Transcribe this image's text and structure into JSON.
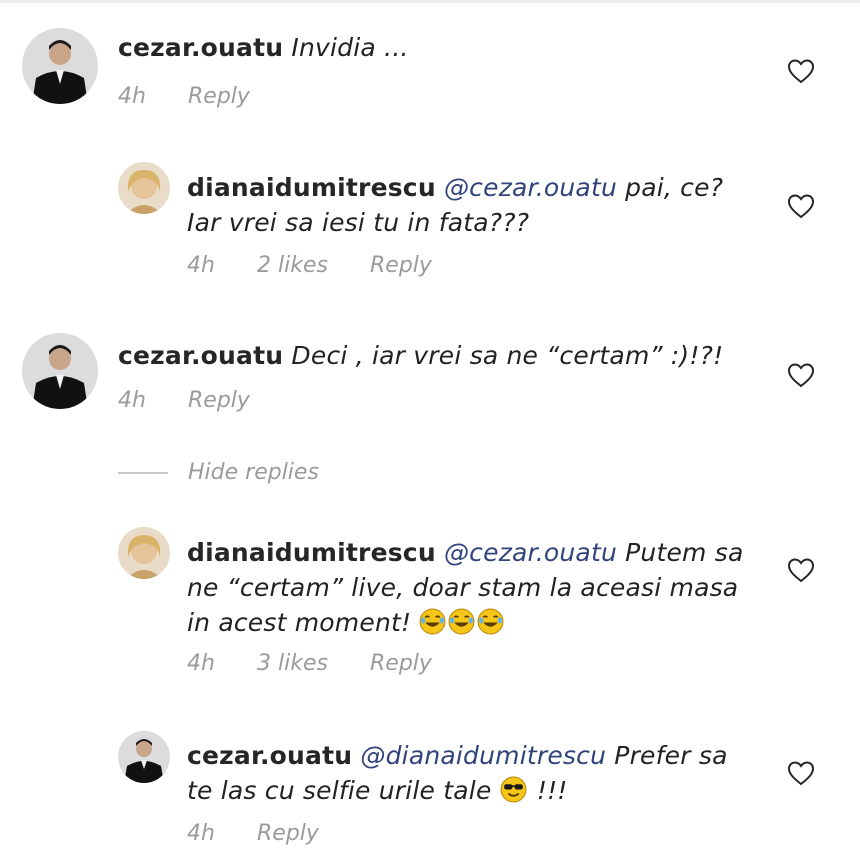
{
  "comments": [
    {
      "username": "cezar.ouatu",
      "mention": "",
      "text": "Invidia ...",
      "time": "4h",
      "likes": "",
      "reply": "Reply"
    },
    {
      "username": "dianaidumitrescu",
      "mention": "@cezar.ouatu",
      "text_line1": "pai, ce?",
      "text_line2": "Iar vrei sa iesi tu in fata???",
      "time": "4h",
      "likes": "2 likes",
      "reply": "Reply"
    },
    {
      "username": "cezar.ouatu",
      "mention": "",
      "text": "Deci , iar vrei sa ne “certam” :)!?!",
      "time": "4h",
      "likes": "",
      "reply": "Reply"
    },
    {
      "username": "dianaidumitrescu",
      "mention": "@cezar.ouatu",
      "text_line1": "Putem sa",
      "text_line2": "ne “certam” live, doar stam la aceasi masa",
      "text_line3": "in acest moment!",
      "time": "4h",
      "likes": "3 likes",
      "reply": "Reply"
    },
    {
      "username": "cezar.ouatu",
      "mention": "@dianaidumitrescu",
      "text_line1": "Prefer sa",
      "text_line2": "te las cu selfie urile tale",
      "text_line2_suffix": "!!!",
      "time": "4h",
      "likes": "",
      "reply": "Reply"
    }
  ],
  "hide_replies": "Hide replies",
  "icons": {
    "like": "heart-outline-icon",
    "emoji_laugh": "tears-of-joy-emoji",
    "emoji_cool": "sunglasses-emoji"
  },
  "colors": {
    "mention": "#30437a",
    "meta": "#9b9b9b",
    "text": "#222222"
  }
}
